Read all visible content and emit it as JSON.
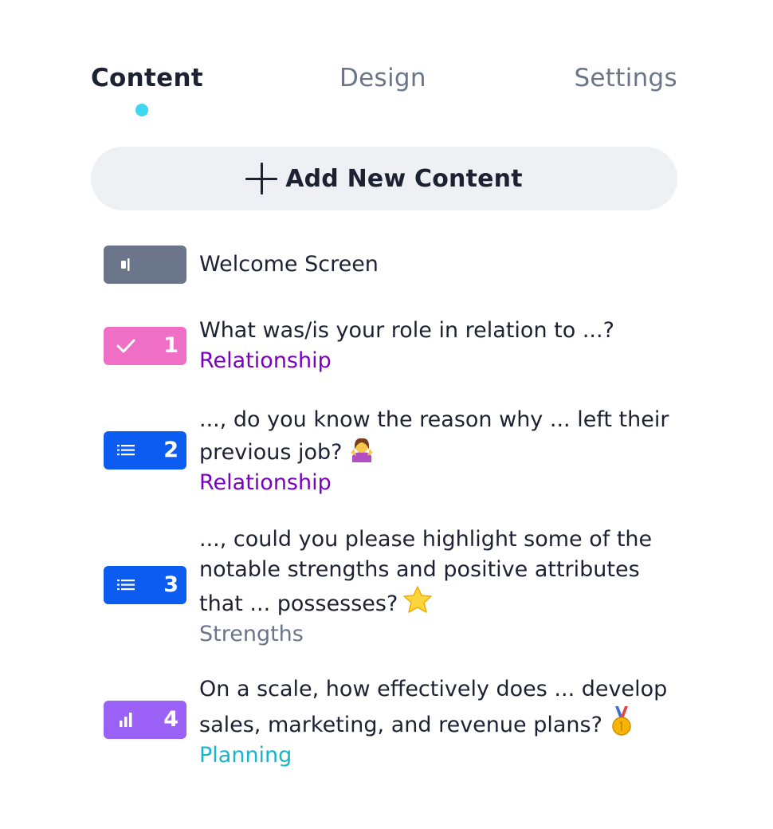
{
  "tabs": [
    {
      "label": "Content",
      "active": true
    },
    {
      "label": "Design",
      "active": false
    },
    {
      "label": "Settings",
      "active": false
    }
  ],
  "add_button": {
    "label": "Add New Content",
    "icon": "plus-icon"
  },
  "items": [
    {
      "number": "",
      "icon": "welcome-screen-icon",
      "badge_color": "#6b7589",
      "lines": [
        "Welcome Screen"
      ],
      "category": "",
      "category_color": "",
      "emoji": ""
    },
    {
      "number": "1",
      "icon": "checkmark-icon",
      "badge_color": "#ee6fc5",
      "lines": [
        "What was/is your role in relation to ...?"
      ],
      "category": "Relationship",
      "category_color": "#7a00c2",
      "emoji": ""
    },
    {
      "number": "2",
      "icon": "long-text-icon",
      "badge_color": "#0d5cf2",
      "lines": [
        "..., do you know the reason why ... left their",
        "previous job?"
      ],
      "category": "Relationship",
      "category_color": "#7a00c2",
      "emoji": "person-shrugging-emoji"
    },
    {
      "number": "3",
      "icon": "long-text-icon",
      "badge_color": "#0d5cf2",
      "lines": [
        "..., could you please highlight some of the",
        "notable strengths and positive attributes",
        "that ... possesses?"
      ],
      "category": "Strengths",
      "category_color": "#6b7589",
      "emoji": "star-emoji"
    },
    {
      "number": "4",
      "icon": "opinion-scale-icon",
      "badge_color": "#9b61f7",
      "lines": [
        "On a scale, how effectively does ... develop",
        "sales, marketing, and revenue plans?"
      ],
      "category": "Planning",
      "category_color": "#16b6c8",
      "emoji": "gold-medal-emoji"
    }
  ]
}
